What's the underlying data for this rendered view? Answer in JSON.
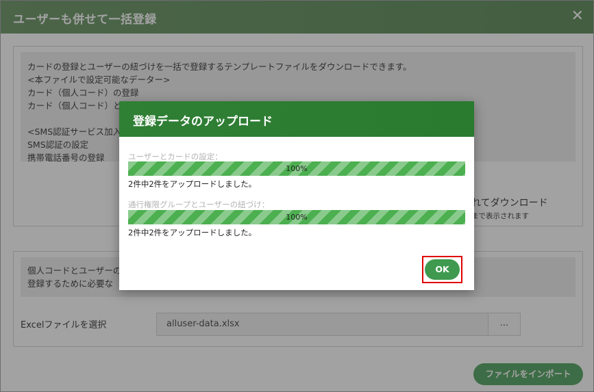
{
  "window": {
    "title": "ユーザーも併せて一括登録",
    "close_label": "✕"
  },
  "section1": {
    "lines": [
      "カードの登録とユーザーの紐づけを一括で登録するテンプレートファイルをダウンロードできます。",
      "<本ファイルで設定可能なデーター>",
      "カード（個人コード）の登録",
      "カード（個人コード）と",
      "",
      "<SMS認証サービス加入",
      "SMS認証の設定",
      "携帯電話番号の登録"
    ],
    "download_text": "れてダウンロード",
    "download_note": "まで表示されます"
  },
  "section2": {
    "lines": [
      "個人コードとユーザーの",
      "登録するために必要な"
    ],
    "excel_label": "Excelファイルを選択",
    "file_value": "alluser-data.xlsx",
    "browse_label": "...",
    "import_label": "ファイルをインポート"
  },
  "modal": {
    "title": "登録データのアップロード",
    "progress": [
      {
        "label": "ユーザーとカードの設定：",
        "percent": 100,
        "percent_text": "100%",
        "note": "2件中2件をアップロードしました。"
      },
      {
        "label": "通行権限グループとユーザーの紐づけ：",
        "percent": 100,
        "percent_text": "100%",
        "note": "2件中2件をアップロードしました。"
      }
    ],
    "ok_label": "OK"
  },
  "colors": {
    "title_bar": "#4a7d46",
    "modal_header": "#2a7a30",
    "progress": "#4caf50",
    "button": "#3f9a4f",
    "highlight": "#e00000"
  }
}
